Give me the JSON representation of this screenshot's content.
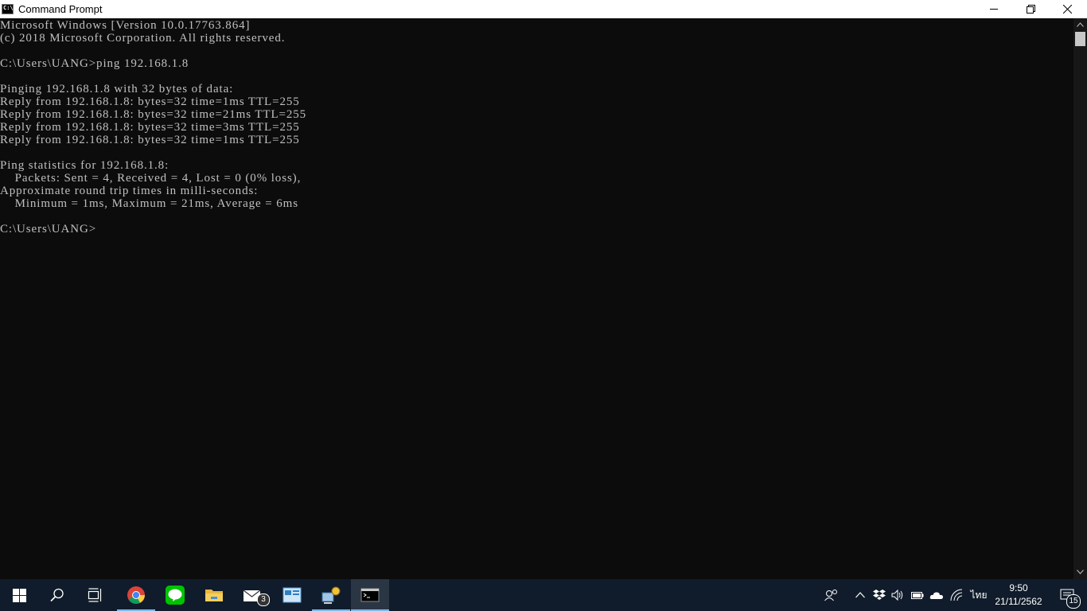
{
  "window": {
    "title": "Command Prompt",
    "app_icon_glyph": "C:\\",
    "controls": {
      "minimize": "minimize-icon",
      "maximize": "restore-icon",
      "close": "close-icon"
    }
  },
  "console": {
    "lines": [
      "Microsoft Windows [Version 10.0.17763.864]",
      "(c) 2018 Microsoft Corporation. All rights reserved.",
      "",
      "C:\\Users\\UANG>ping 192.168.1.8",
      "",
      "Pinging 192.168.1.8 with 32 bytes of data:",
      "Reply from 192.168.1.8: bytes=32 time=1ms TTL=255",
      "Reply from 192.168.1.8: bytes=32 time=21ms TTL=255",
      "Reply from 192.168.1.8: bytes=32 time=3ms TTL=255",
      "Reply from 192.168.1.8: bytes=32 time=1ms TTL=255",
      "",
      "Ping statistics for 192.168.1.8:",
      "    Packets: Sent = 4, Received = 4, Lost = 0 (0% loss),",
      "Approximate round trip times in milli-seconds:",
      "    Minimum = 1ms, Maximum = 21ms, Average = 6ms",
      "",
      "C:\\Users\\UANG>"
    ]
  },
  "taskbar": {
    "mail_badge": "3",
    "language": "ไทย",
    "clock_time": "9:50",
    "clock_date": "21/11/2562",
    "notification_count": "15"
  },
  "colors": {
    "console_bg": "#0c0c0c",
    "console_text": "#c0c0c0",
    "taskbar_bg": "#101c2b",
    "accent": "#76b9ed"
  }
}
